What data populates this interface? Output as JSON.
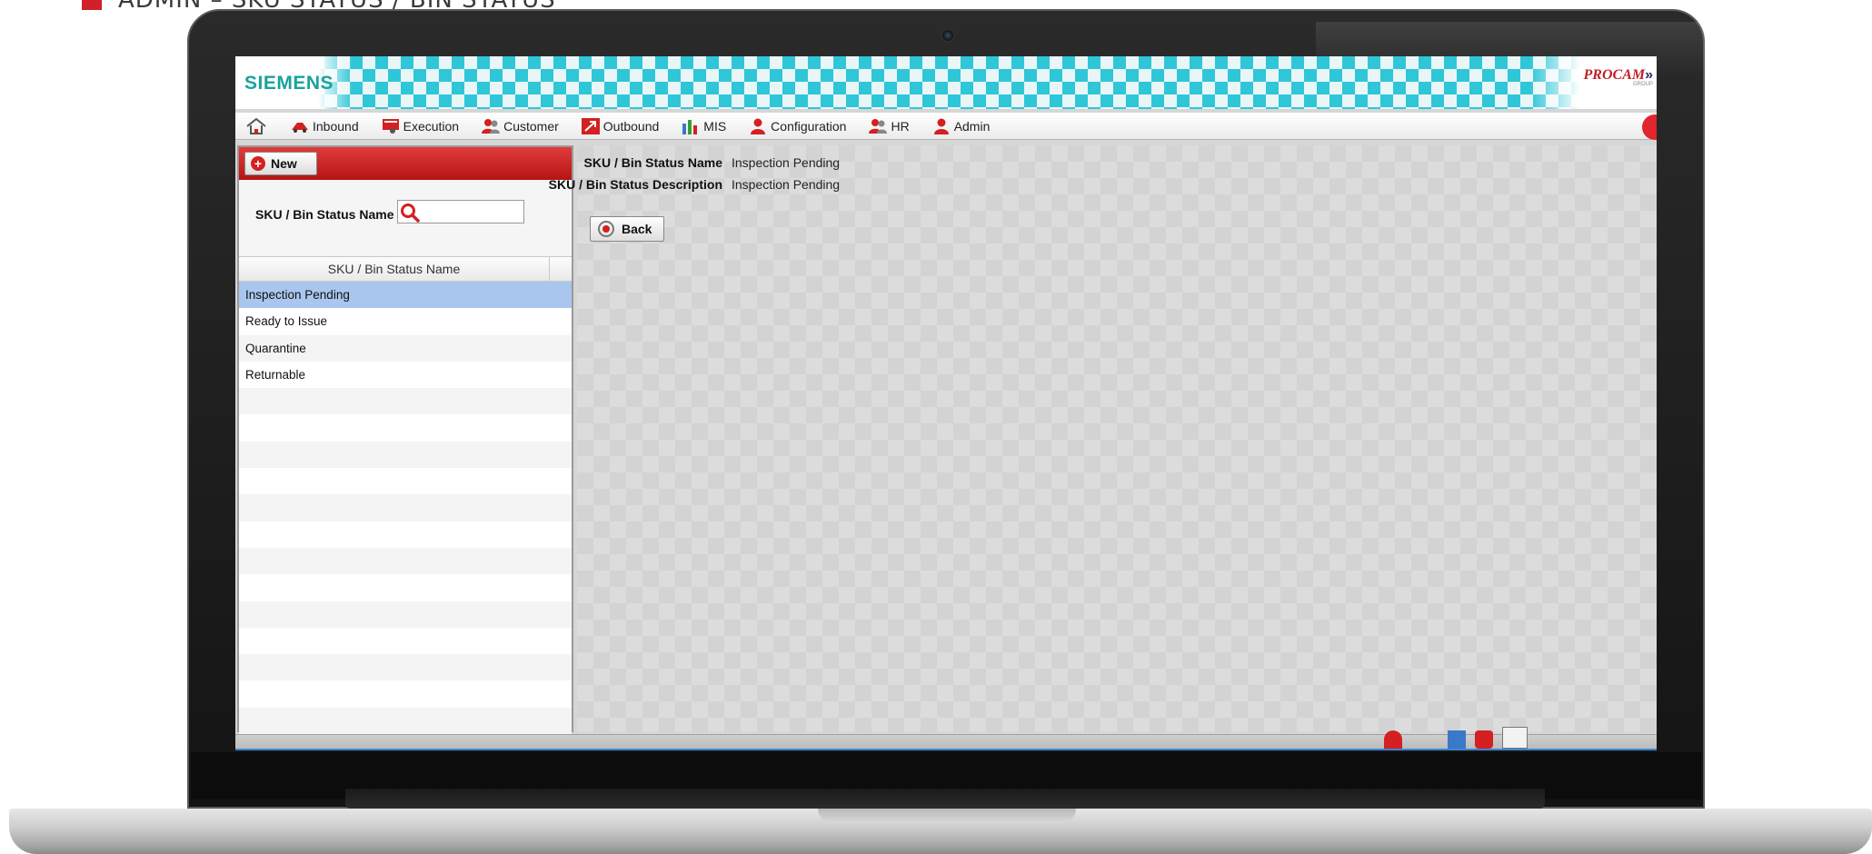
{
  "caption": {
    "text": "ADMIN – SKU STATUS / BIN STATUS"
  },
  "header": {
    "brand": "SIEMENS",
    "partner": "PROCAM",
    "partner_tagline": "GROUP"
  },
  "menu": {
    "items": [
      {
        "label": "Inbound",
        "icon": "truck-icon"
      },
      {
        "label": "Execution",
        "icon": "execution-icon"
      },
      {
        "label": "Customer",
        "icon": "users-icon"
      },
      {
        "label": "Outbound",
        "icon": "outbound-icon"
      },
      {
        "label": "MIS",
        "icon": "bar-chart-icon"
      },
      {
        "label": "Configuration",
        "icon": "user-icon"
      },
      {
        "label": "HR",
        "icon": "users-icon"
      },
      {
        "label": "Admin",
        "icon": "user-icon"
      }
    ]
  },
  "left_panel": {
    "new_label": "New",
    "search_label": "SKU / Bin Status Name",
    "search_value": "",
    "column_header": "SKU / Bin Status Name",
    "rows": [
      "Inspection Pending",
      "Ready to Issue",
      "Quarantine",
      "Returnable"
    ],
    "selected_index": 0
  },
  "detail": {
    "name_label": "SKU / Bin Status Name",
    "name_value": "Inspection Pending",
    "description_label": "SKU / Bin Status Description",
    "description_value": "Inspection Pending",
    "back_label": "Back"
  },
  "colors": {
    "accent_red": "#d0202a",
    "header_teal": "#2fc6d8",
    "selected_row": "#a9c6ee"
  }
}
